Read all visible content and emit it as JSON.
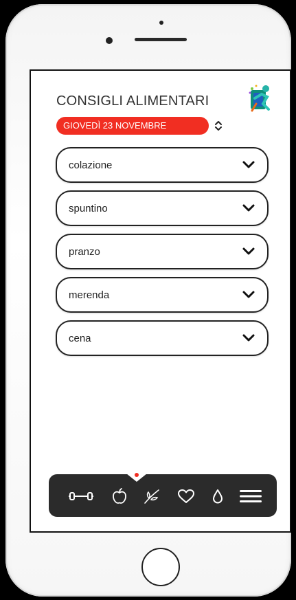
{
  "header": {
    "title": "CONSIGLI ALIMENTARI",
    "date": "GIOVEDÌ 23 NOVEMBRE",
    "logo_icon": "runner-logo-icon",
    "stepper_icon": "up-down-chevron-icon"
  },
  "meals": [
    {
      "label": "colazione",
      "icon": "chevron-down-icon"
    },
    {
      "label": "spuntino",
      "icon": "chevron-down-icon"
    },
    {
      "label": "pranzo",
      "icon": "chevron-down-icon"
    },
    {
      "label": "merenda",
      "icon": "chevron-down-icon"
    },
    {
      "label": "cena",
      "icon": "chevron-down-icon"
    }
  ],
  "tabbar": {
    "items": [
      {
        "icon": "dumbbell-icon",
        "active": false
      },
      {
        "icon": "apple-icon",
        "active": true
      },
      {
        "icon": "leaf-icon",
        "active": false
      },
      {
        "icon": "heart-icon",
        "active": false
      },
      {
        "icon": "water-drop-icon",
        "active": false
      },
      {
        "icon": "menu-icon",
        "active": false
      }
    ]
  },
  "colors": {
    "accent": "#f12e22",
    "tabbar": "#2b2b2b",
    "text": "#222222"
  }
}
